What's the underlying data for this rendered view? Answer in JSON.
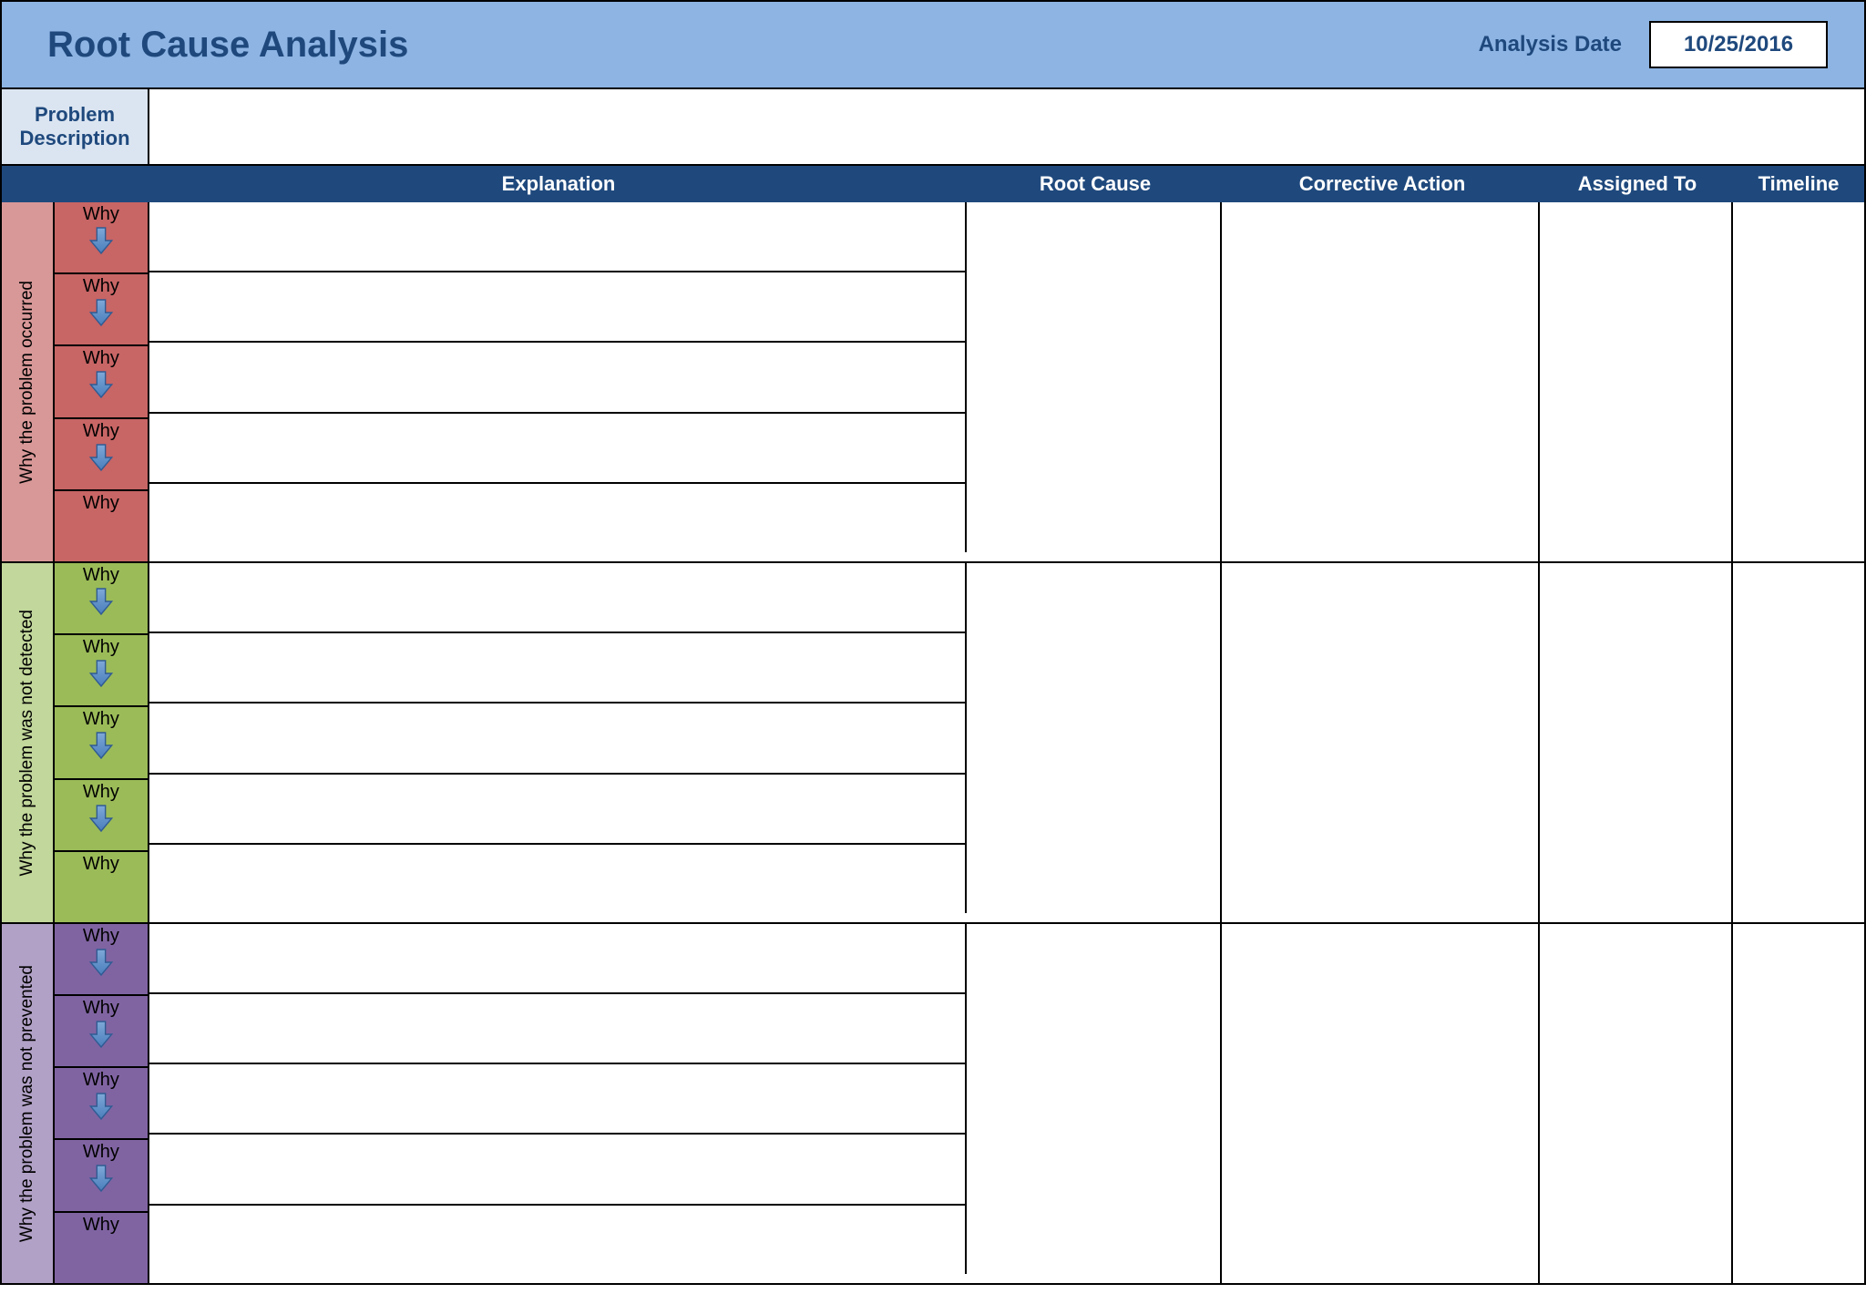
{
  "header": {
    "title": "Root Cause Analysis",
    "date_label": "Analysis Date",
    "date_value": "10/25/2016"
  },
  "problem": {
    "label": "Problem Description",
    "value": ""
  },
  "columns": {
    "explanation": "Explanation",
    "root_cause": "Root Cause",
    "corrective_action": "Corrective Action",
    "assigned_to": "Assigned To",
    "timeline": "Timeline"
  },
  "why_text": "Why",
  "sections": [
    {
      "label": "Why the problem occurred",
      "color": "red",
      "root_cause": "",
      "corrective_action": "",
      "assigned_to": "",
      "timeline": ""
    },
    {
      "label": "Why the problem was not detected",
      "color": "green",
      "root_cause": "",
      "corrective_action": "",
      "assigned_to": "",
      "timeline": ""
    },
    {
      "label": "Why the problem was not prevented",
      "color": "purple",
      "root_cause": "",
      "corrective_action": "",
      "assigned_to": "",
      "timeline": ""
    }
  ]
}
